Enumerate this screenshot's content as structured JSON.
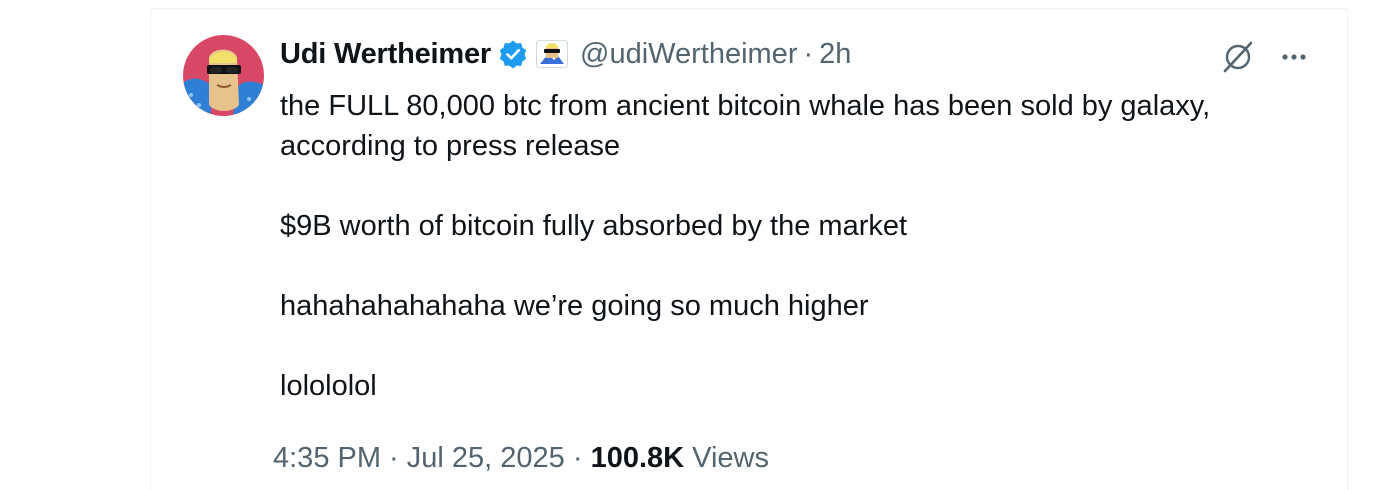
{
  "tweet": {
    "author_name": "Udi Wertheimer",
    "handle": "@udiWertheimer",
    "separator": "·",
    "relative_time": "2h",
    "lines": [
      "the FULL 80,000 btc from ancient bitcoin whale has been sold by galaxy,",
      "according to press release",
      "$9B worth of bitcoin fully absorbed by the market",
      "hahahahahahaha we’re going so much higher",
      "lolololol"
    ],
    "timestamp": "4:35 PM · Jul 25, 2025",
    "meta_separator": "·",
    "views_count": "100.8K",
    "views_label": "Views"
  },
  "icons": {
    "verified": "verified-badge-icon",
    "affiliate": "affiliate-badge-icon",
    "grok": "grok-icon",
    "more": "more-options-icon"
  },
  "colors": {
    "verified_blue": "#1d9bf0",
    "secondary_text": "#536471",
    "primary_text": "#0f1419"
  }
}
